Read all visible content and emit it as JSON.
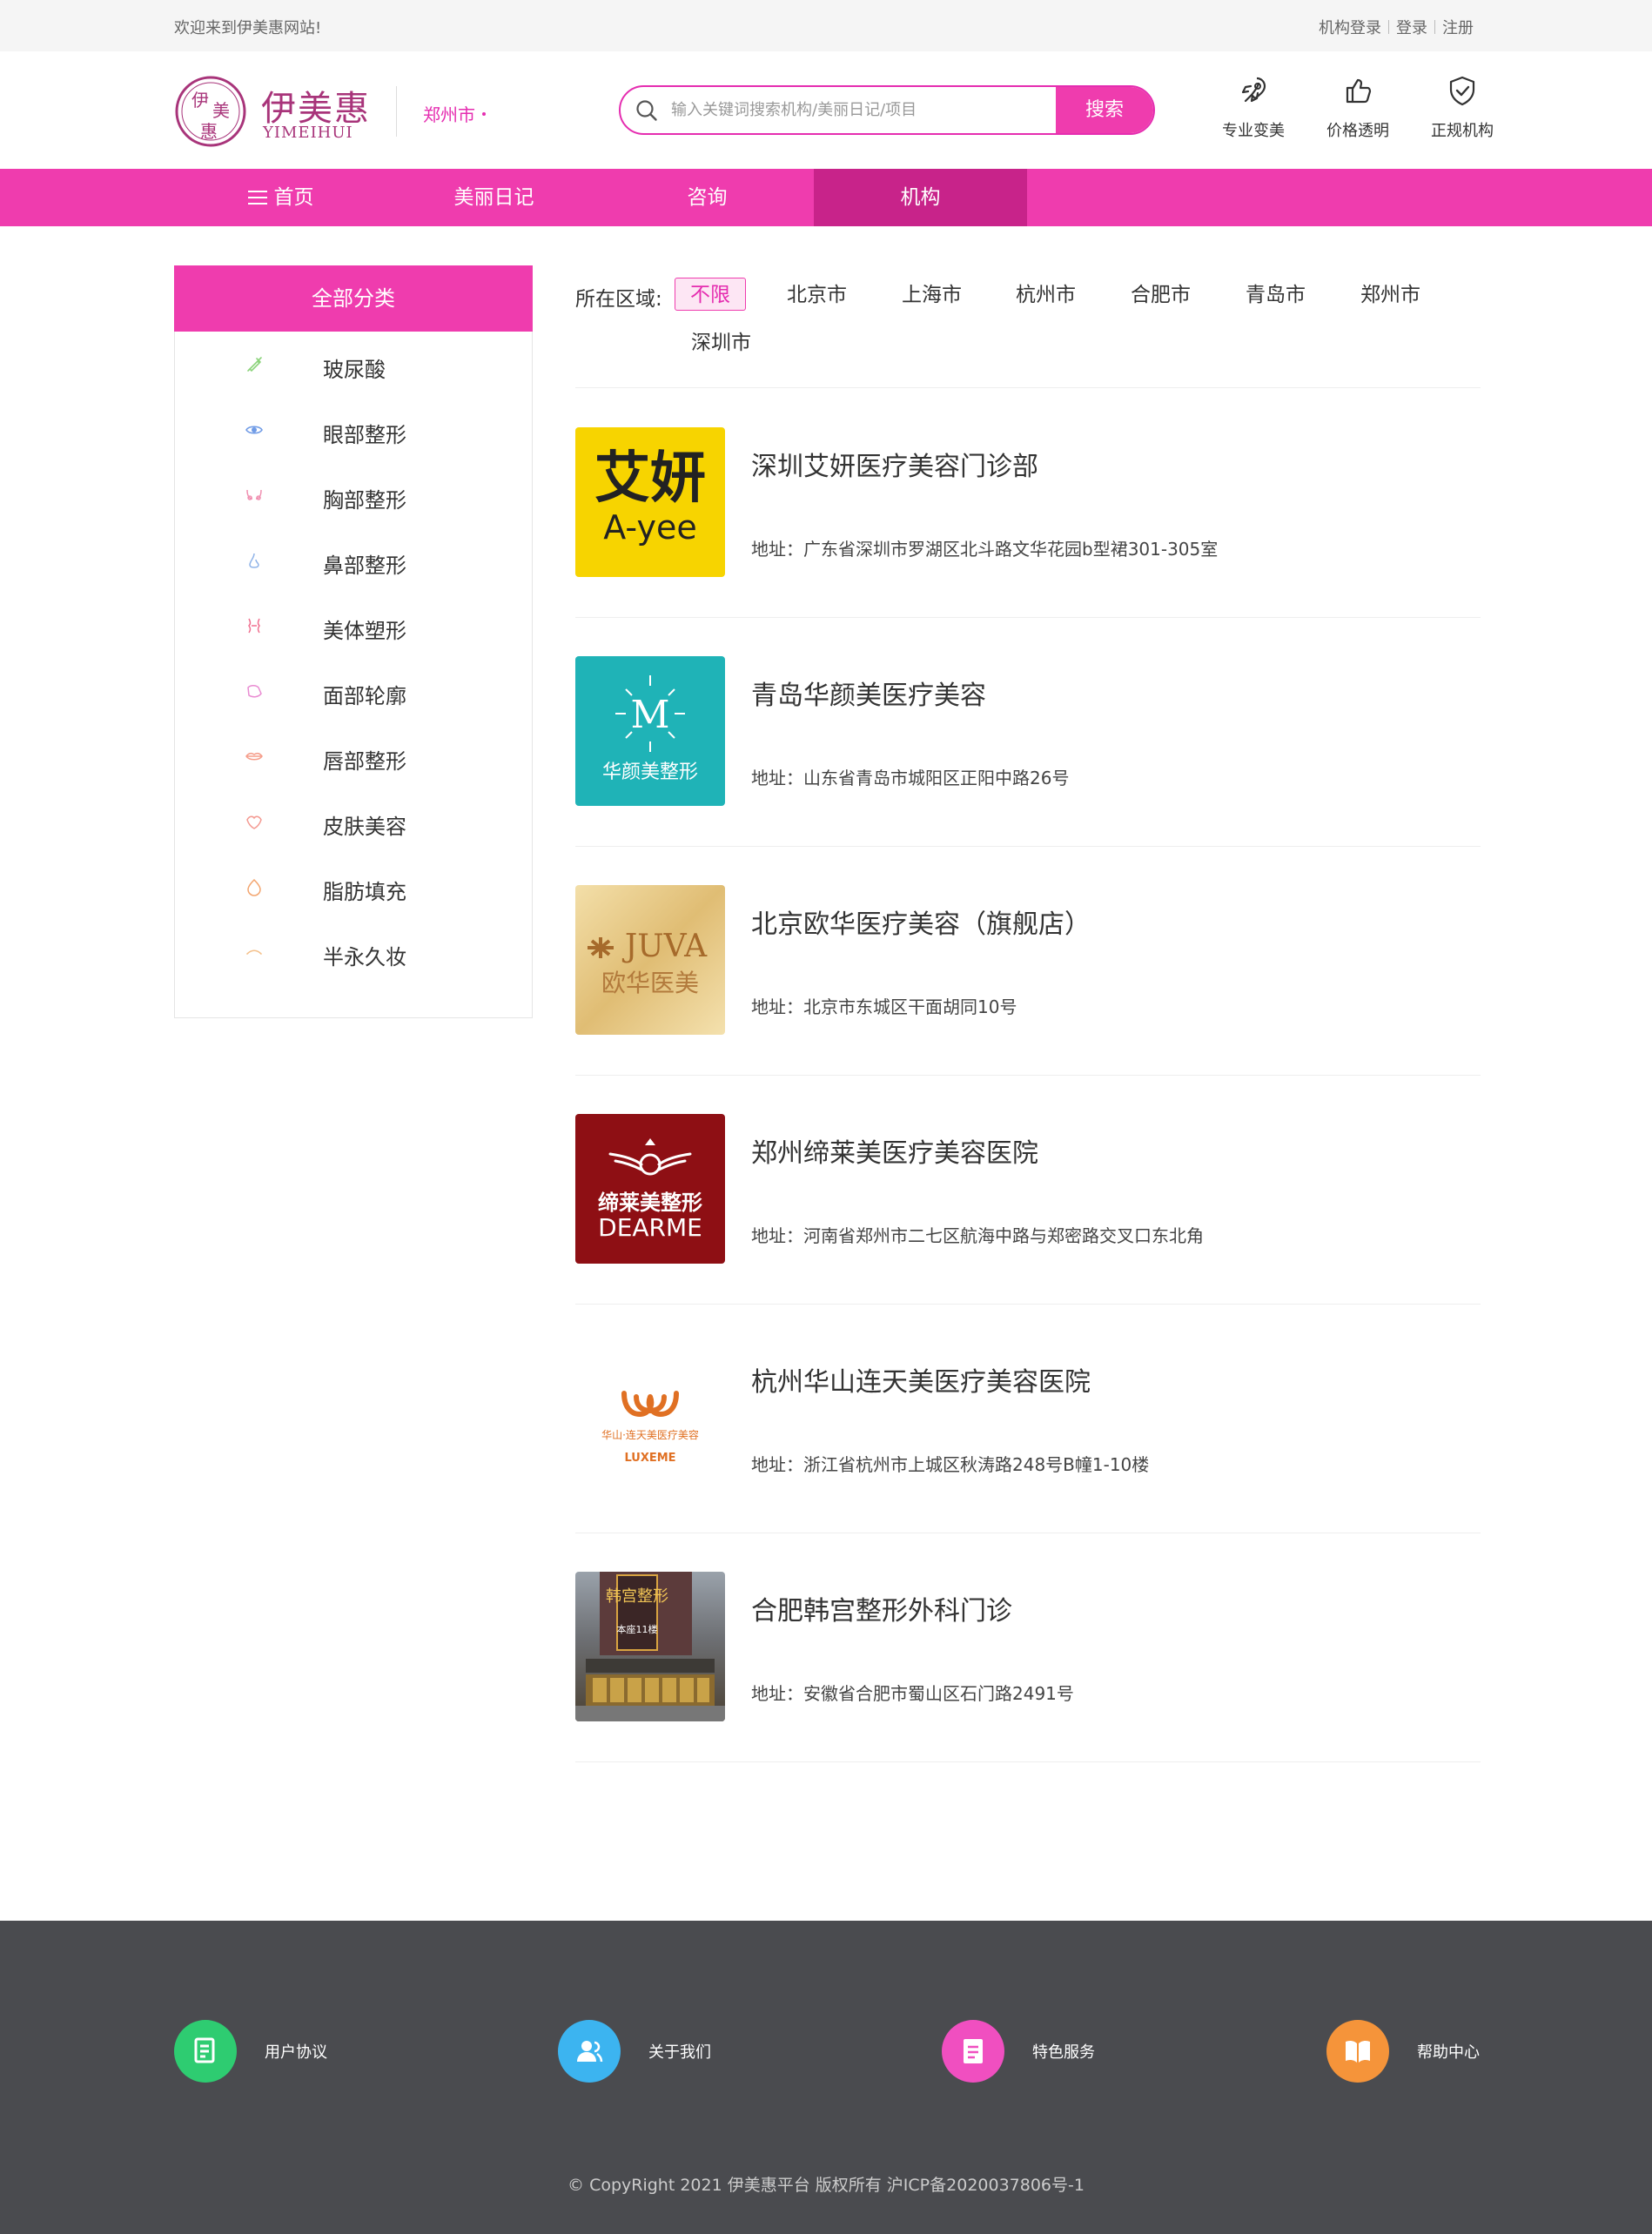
{
  "topbar": {
    "welcome": "欢迎来到伊美惠网站!",
    "org_login": "机构登录",
    "login": "登录",
    "register": "注册"
  },
  "header": {
    "logo_text": "伊美惠",
    "logo_sub": "YIMEIHUI",
    "logo_mark_chars": [
      "伊",
      "美",
      "惠"
    ],
    "city": "郑州市",
    "search_placeholder": "输入关键词搜索机构/美丽日记/项目",
    "search_button": "搜索",
    "features": [
      {
        "icon": "rocket-icon",
        "label": "专业变美"
      },
      {
        "icon": "thumbs-up-icon",
        "label": "价格透明"
      },
      {
        "icon": "shield-check-icon",
        "label": "正规机构"
      }
    ]
  },
  "nav": {
    "items": [
      {
        "label": "首页",
        "icon": "menu-icon"
      },
      {
        "label": "美丽日记"
      },
      {
        "label": "咨询"
      },
      {
        "label": "机构",
        "active": true
      }
    ]
  },
  "sidebar": {
    "title": "全部分类",
    "categories": [
      {
        "label": "玻尿酸",
        "icon": "syringe-icon",
        "color": "#8bd37a"
      },
      {
        "label": "眼部整形",
        "icon": "eye-icon",
        "color": "#6f9be6"
      },
      {
        "label": "胸部整形",
        "icon": "chest-icon",
        "color": "#f08fb0"
      },
      {
        "label": "鼻部整形",
        "icon": "nose-icon",
        "color": "#8fb3e8"
      },
      {
        "label": "美体塑形",
        "icon": "body-icon",
        "color": "#f06f8f"
      },
      {
        "label": "面部轮廓",
        "icon": "face-icon",
        "color": "#e98bd2"
      },
      {
        "label": "唇部整形",
        "icon": "lips-icon",
        "color": "#f59d8a"
      },
      {
        "label": "皮肤美容",
        "icon": "skin-icon",
        "color": "#f49a92"
      },
      {
        "label": "脂肪填充",
        "icon": "fat-icon",
        "color": "#f3a56f"
      },
      {
        "label": "半永久妆",
        "icon": "brow-icon",
        "color": "#f4c08a"
      }
    ]
  },
  "filter": {
    "label": "所在区域:",
    "options": [
      "不限",
      "北京市",
      "上海市",
      "杭州市",
      "合肥市",
      "青岛市",
      "郑州市",
      "深圳市"
    ],
    "selected": "不限"
  },
  "institutions": [
    {
      "name": "深圳艾妍医疗美容门诊部",
      "address": "地址：广东省深圳市罗湖区北斗路文华花园b型裙301-305室",
      "logo": {
        "style": "ayee",
        "bg": "#f7d400",
        "line1": "艾妍",
        "line2": "A-yee"
      }
    },
    {
      "name": "青岛华颜美医疗美容",
      "address": "地址：山东省青岛市城阳区正阳中路26号",
      "logo": {
        "style": "huayan",
        "bg": "#1fb3b7",
        "line1": "M",
        "line2": "华颜美整形"
      }
    },
    {
      "name": "北京欧华医疗美容（旗舰店）",
      "address": "地址：北京市东城区干面胡同10号",
      "logo": {
        "style": "juva",
        "bg": "#e6c98a",
        "line1": "JUVA",
        "line2": "欧华医美"
      }
    },
    {
      "name": "郑州缔莱美医疗美容医院",
      "address": "地址：河南省郑州市二七区航海中路与郑密路交叉口东北角",
      "logo": {
        "style": "dearme",
        "bg": "#8e0f14",
        "line1": "缔莱美整形",
        "line2": "DEARME"
      }
    },
    {
      "name": "杭州华山连天美医疗美容医院",
      "address": "地址：浙江省杭州市上城区秋涛路248号B幢1-10楼",
      "logo": {
        "style": "luxeme",
        "bg": "#ffffff",
        "line1": "华山·连天美医疗美容",
        "line2": "LUXEME"
      }
    },
    {
      "name": "合肥韩宫整形外科门诊",
      "address": "地址：安徽省合肥市蜀山区石门路2491号",
      "logo": {
        "style": "hangong",
        "bg": "#6a6a6a",
        "line1": "韩宫整形",
        "line2": "本座11楼"
      }
    }
  ],
  "footer": {
    "links": [
      {
        "label": "用户协议",
        "icon": "document-icon",
        "color": "#2ecc71"
      },
      {
        "label": "关于我们",
        "icon": "users-icon",
        "color": "#3cb4f0"
      },
      {
        "label": "特色服务",
        "icon": "clipboard-icon",
        "color": "#f04fc0"
      },
      {
        "label": "帮助中心",
        "icon": "book-icon",
        "color": "#f5943a"
      }
    ],
    "copyright": "© CopyRight 2021  伊美惠平台  版权所有     沪ICP备2020037806号-1"
  },
  "colors": {
    "brand": "#ef3cae",
    "brand_dark": "#c8238a",
    "logo": "#a8347a",
    "footer_bg": "#4a4b4f"
  }
}
